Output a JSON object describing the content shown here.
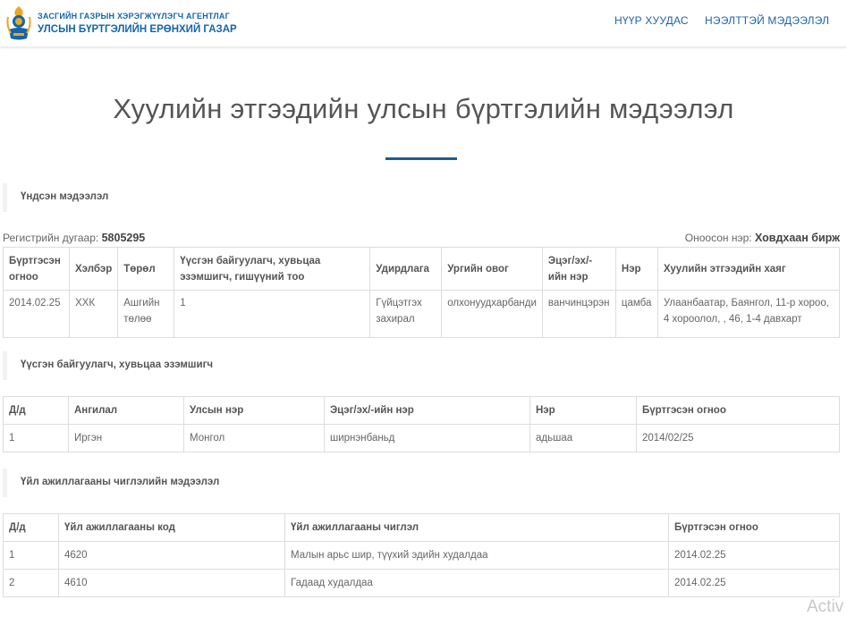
{
  "header": {
    "org_line1": "ЗАСГИЙН ГАЗРЫН ХЭРЭГЖҮҮЛЭГЧ АГЕНТЛАГ",
    "org_line2": "УЛСЫН БҮРТГЭЛИЙН ЕРӨНХИЙ ГАЗАР",
    "nav": [
      {
        "label": "НҮҮР ХУУДАС"
      },
      {
        "label": "НЭЭЛТТЭЙ МЭДЭЭЛЭЛ"
      }
    ]
  },
  "page": {
    "title": "Хуулийн этгээдийн улсын бүртгэлийн мэдээлэл"
  },
  "basic": {
    "section_title": "Үндсэн мэдээлэл",
    "reg_label": "Регистрийн дугаар:",
    "reg_value": "5805295",
    "name_label": "Оноосон нэр:",
    "name_value": "Ховдхаан бирж",
    "headers": [
      "Бүртгэсэн огноо",
      "Хэлбэр",
      "Төрөл",
      "Үүсгэн байгуулагч, хувьцаа эзэмшигч, гишүүний тоо",
      "Удирдлага",
      "Ургийн овог",
      "Эцэг/эх/-ийн нэр",
      "Нэр",
      "Хуулийн этгээдийн хаяг"
    ],
    "row": [
      "2014.02.25",
      "ХХК",
      "Ашгийн төлөө",
      "1",
      "Гүйцэтгэх захирал",
      "олхонуудхарбанди",
      "ванчинцэрэн",
      "цамба",
      "Улаанбаатар, Баянгол, 11-р хороо, 4 хороолол, , 46, 1-4 давхарт"
    ]
  },
  "founders": {
    "section_title": "Үүсгэн байгуулагч, хувьцаа эзэмшигч",
    "headers": [
      "Д/д",
      "Ангилал",
      "Улсын нэр",
      "Эцэг/эх/-ийн нэр",
      "Нэр",
      "Бүртгэсэн огноо"
    ],
    "rows": [
      [
        "1",
        "Иргэн",
        "Монгол",
        "ширнэнбаньд",
        "адьшаа",
        "2014/02/25"
      ]
    ]
  },
  "activities": {
    "section_title": "Үйл ажиллагааны чиглэлийн мэдээлэл",
    "headers": [
      "Д/д",
      "Үйл ажиллагааны код",
      "Үйл ажиллагааны чиглэл",
      "Бүртгэсэн огноо"
    ],
    "rows": [
      [
        "1",
        "4620",
        "Малын арьс шир, түүхий эдийн худалдаа",
        "2014.02.25"
      ],
      [
        "2",
        "4610",
        "Гадаад худалдаа",
        "2014.02.25"
      ]
    ]
  },
  "watermark": "Activ",
  "colors": {
    "brand_blue": "#1565a8",
    "title_rule": "#1f5b8f",
    "logo_gold": "#e9a823"
  }
}
